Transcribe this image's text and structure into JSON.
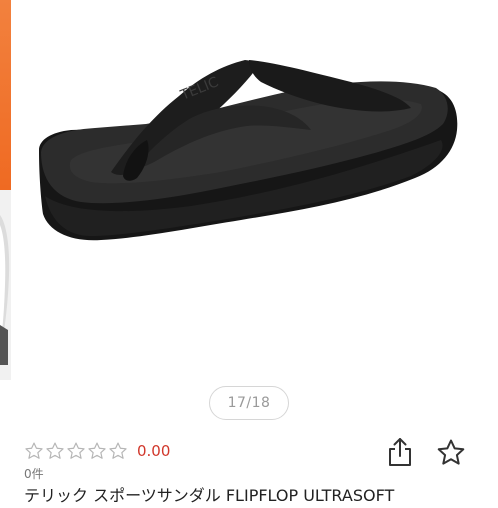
{
  "gallery": {
    "image_alt": "Black flip-flop sandal",
    "logo_text": "TELIC",
    "counter": "17/18"
  },
  "product": {
    "rating_stars": 0,
    "rating_max": 5,
    "score": "0.00",
    "review_count": "0件",
    "title": "テリック スポーツサンダル FLIPFLOP ULTRASOFT"
  },
  "icons": {
    "star_empty": "star-outline-icon",
    "share": "share-icon",
    "favorite": "star-favorite-icon"
  },
  "colors": {
    "score": "#d1372b",
    "star_outline": "#b5b5b5",
    "sandal": "#262626"
  }
}
